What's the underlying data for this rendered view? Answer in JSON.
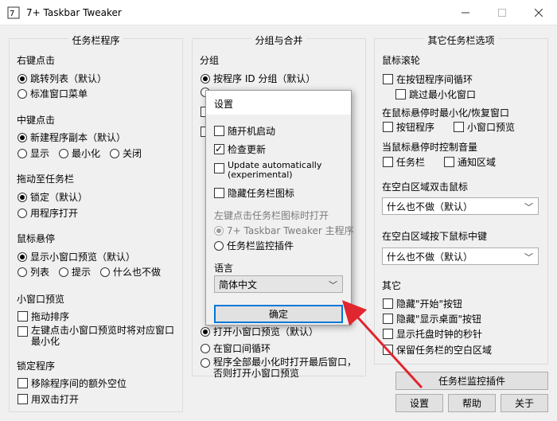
{
  "window": {
    "title": "7+ Taskbar Tweaker"
  },
  "left": {
    "title": "任务栏程序",
    "right_click": {
      "label": "右键点击",
      "opt1": "跳转列表（默认）",
      "opt2": "标准窗口菜单"
    },
    "middle_click": {
      "label": "中键点击",
      "opt1": "新建程序副本（默认）",
      "opt2": "显示",
      "opt3": "最小化",
      "opt4": "关闭"
    },
    "drag": {
      "label": "拖动至任务栏",
      "opt1": "锁定（默认）",
      "opt2": "用程序打开"
    },
    "hover": {
      "label": "鼠标悬停",
      "opt1": "显示小窗口预览（默认）",
      "opt2": "列表",
      "opt3": "提示",
      "opt4": "什么也不做"
    },
    "thumb": {
      "label": "小窗口预览",
      "opt1": "拖动排序",
      "opt2_line1": "左键点击小窗口预览时将对应窗口",
      "opt2_line2": "最小化"
    },
    "lock": {
      "label": "锁定程序",
      "opt1": "移除程序间的额外空位",
      "opt2": "用双击打开"
    }
  },
  "middle": {
    "title": "分组与合并",
    "group": {
      "label": "分组",
      "opt1": "按程序 ID 分组（默认）"
    },
    "bottom": {
      "opt1": "打开小窗口预览（默认）",
      "opt2": "在窗口间循环",
      "opt3_line1": "程序全部最小化时打开最后窗口，",
      "opt3_line2": "否则打开小窗口预览"
    }
  },
  "right": {
    "title": "其它任务栏选项",
    "wheel": {
      "label": "鼠标滚轮",
      "opt1": "在按钮程序间循环",
      "opt2": "跳过最小化窗口"
    },
    "hover_min": {
      "label": "在鼠标悬停时最小化/恢复窗口",
      "opt1": "按钮程序",
      "opt2": "小窗口预览"
    },
    "volume": {
      "label": "当鼠标悬停时控制音量",
      "opt1": "任务栏",
      "opt2": "通知区域"
    },
    "dblclick": {
      "label": "在空白区域双击鼠标",
      "value": "什么也不做（默认）"
    },
    "midclick": {
      "label": "在空白区域按下鼠标中键",
      "value": "什么也不做（默认）"
    },
    "other": {
      "label": "其它",
      "opt1": "隐藏\"开始\"按钮",
      "opt2": "隐藏\"显示桌面\"按钮",
      "opt3": "显示托盘时钟的秒针",
      "opt4": "保留任务栏的空白区域"
    }
  },
  "buttons": {
    "inspector": "任务栏监控插件",
    "settings": "设置",
    "help": "帮助",
    "about": "关于"
  },
  "dialog": {
    "title": "设置",
    "autostart": "随开机启动",
    "check_updates": "检查更新",
    "auto_update_line1": "Update automatically",
    "auto_update_line2": "(experimental)",
    "hide_tray_icon": "隐藏任务栏图标",
    "left_click_label": "左键点击任务栏图标时打开",
    "left_opt1": "7+ Taskbar Tweaker 主程序",
    "left_opt2": "任务栏监控插件",
    "language_label": "语言",
    "language_value": "简体中文",
    "ok": "确定"
  },
  "colors": {
    "arrow": "#e0262e",
    "ok_border": "#0078d7"
  }
}
